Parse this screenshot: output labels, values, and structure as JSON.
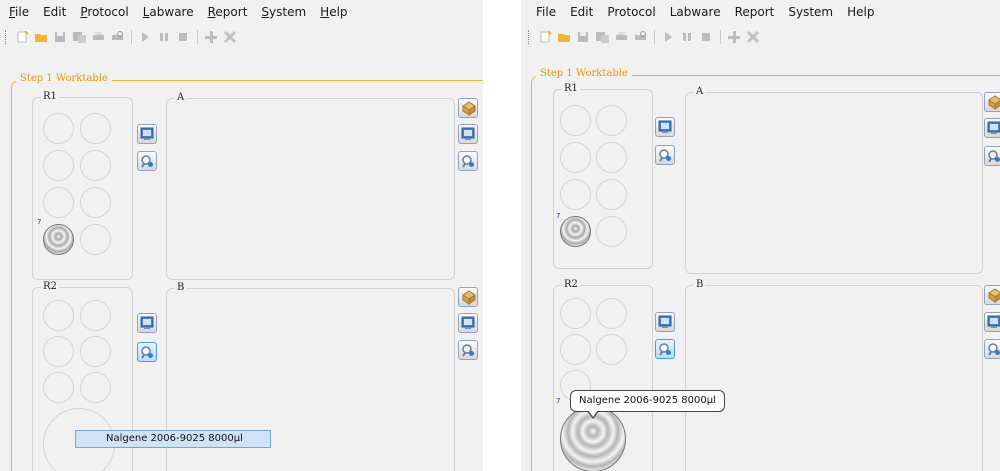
{
  "menu": [
    "File",
    "Edit",
    "Protocol",
    "Labware",
    "Report",
    "System",
    "Help"
  ],
  "toolbar_icons": [
    "new-icon",
    "open-icon",
    "save-icon",
    "save-as-icon",
    "print-icon",
    "print-preview-icon",
    "run-icon",
    "pause-icon",
    "stop-icon",
    "add-icon",
    "delete-icon"
  ],
  "worktable": {
    "title": "Step 1 Worktable",
    "racks": [
      {
        "label": "R1",
        "position_number": "7"
      },
      {
        "label": "R2",
        "position_number": "7"
      }
    ],
    "areas": [
      {
        "label": "A"
      },
      {
        "label": "B"
      }
    ]
  },
  "tooltip": {
    "text": "Nalgene 2006-9025 8000µl"
  },
  "colors": {
    "worktable_border": "#f2b236",
    "worktable_title": "#e59500",
    "tooltip_highlight": "#cfe3f8",
    "panel_background": "#f1f1f1"
  }
}
